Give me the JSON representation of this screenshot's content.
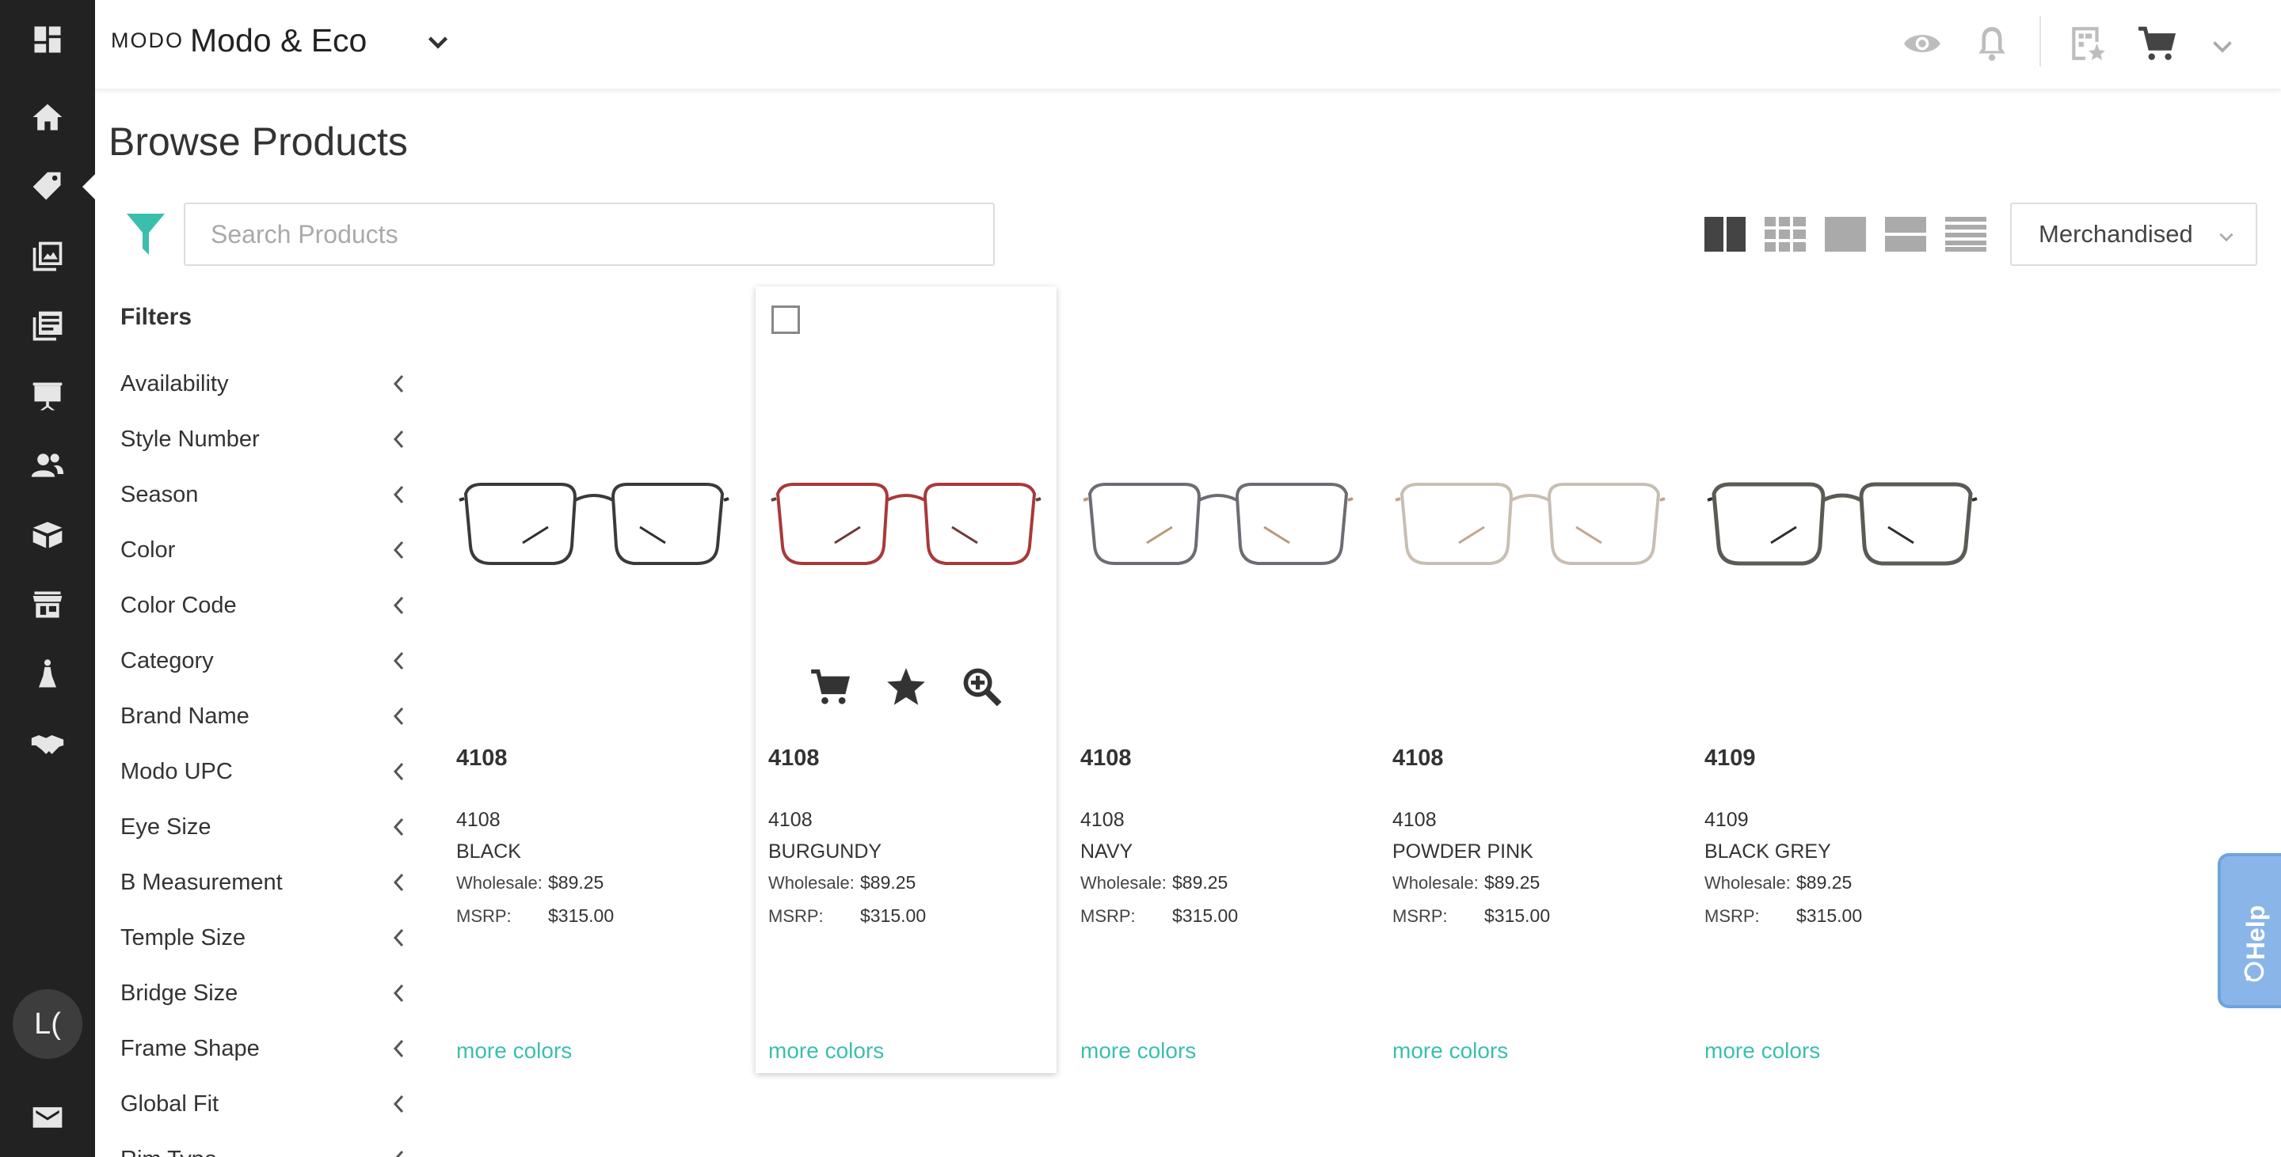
{
  "app": {
    "logo": "MODO",
    "brand": "Modo & Eco"
  },
  "sidebar": {
    "items": [
      {
        "name": "dashboard-icon"
      },
      {
        "name": "home-icon"
      },
      {
        "name": "tag-icon",
        "active": true
      },
      {
        "name": "gallery-icon"
      },
      {
        "name": "catalog-icon"
      },
      {
        "name": "presentation-icon"
      },
      {
        "name": "users-icon"
      },
      {
        "name": "box-icon"
      },
      {
        "name": "store-icon"
      },
      {
        "name": "mannequin-icon"
      },
      {
        "name": "handshake-icon"
      }
    ],
    "avatar": "L(",
    "bottom_icon": "card-icon"
  },
  "header": {
    "icons": [
      "eye-icon",
      "bell-icon",
      "quick-order-icon",
      "cart-icon",
      "chevron-down-icon"
    ]
  },
  "page": {
    "title": "Browse Products",
    "search_placeholder": "Search Products",
    "sort_value": "Merchandised",
    "view_modes": [
      "two-column-view-icon",
      "grid-view-icon",
      "large-view-icon",
      "row-view-icon",
      "list-view-icon"
    ]
  },
  "filters": {
    "title": "Filters",
    "items": [
      "Availability",
      "Style Number",
      "Season",
      "Color",
      "Color Code",
      "Category",
      "Brand Name",
      "Modo UPC",
      "Eye Size",
      "B Measurement",
      "Temple Size",
      "Bridge Size",
      "Frame Shape",
      "Global Fit",
      "Rim Type"
    ]
  },
  "products": [
    {
      "title": "4108",
      "style": "4108",
      "color": "BLACK",
      "wholesale_label": "Wholesale:",
      "wholesale": "$89.25",
      "msrp_label": "MSRP:",
      "msrp": "$315.00",
      "more": "more colors",
      "frame_color": "#3a3a3a",
      "temple_color": "#2e2e2e"
    },
    {
      "title": "4108",
      "style": "4108",
      "color": "BURGUNDY",
      "wholesale_label": "Wholesale:",
      "wholesale": "$89.25",
      "msrp_label": "MSRP:",
      "msrp": "$315.00",
      "more": "more colors",
      "frame_color": "#a8393a",
      "temple_color": "#6b3b3a"
    },
    {
      "title": "4108",
      "style": "4108",
      "color": "NAVY",
      "wholesale_label": "Wholesale:",
      "wholesale": "$89.25",
      "msrp_label": "MSRP:",
      "msrp": "$315.00",
      "more": "more colors",
      "frame_color": "#6e6b73",
      "temple_color": "#b89a7a"
    },
    {
      "title": "4108",
      "style": "4108",
      "color": "POWDER PINK",
      "wholesale_label": "Wholesale:",
      "wholesale": "$89.25",
      "msrp_label": "MSRP:",
      "msrp": "$315.00",
      "more": "more colors",
      "frame_color": "#c9beb3",
      "temple_color": "#c2a690"
    },
    {
      "title": "4109",
      "style": "4109",
      "color": "BLACK GREY",
      "wholesale_label": "Wholesale:",
      "wholesale": "$89.25",
      "msrp_label": "MSRP:",
      "msrp": "$315.00",
      "more": "more colors",
      "frame_color": "#5b5a55",
      "temple_color": "#2f2f2f"
    }
  ],
  "help": {
    "label": "Help"
  },
  "colors": {
    "accent": "#3bbfad",
    "sidebar_bg": "#222222",
    "help_bg": "#8ab5e8"
  }
}
